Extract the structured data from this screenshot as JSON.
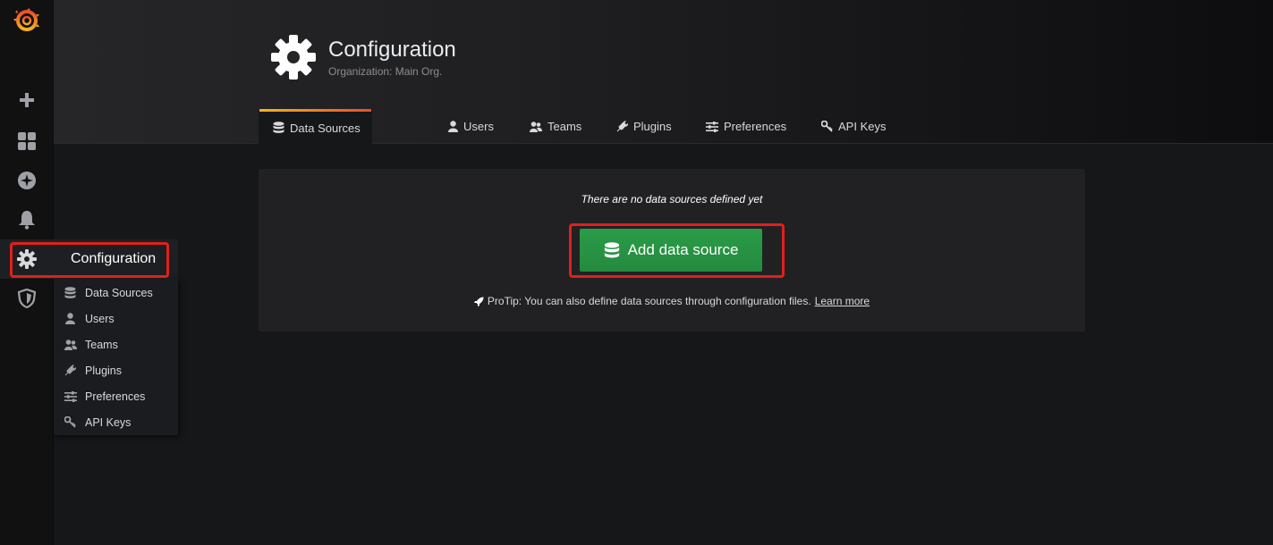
{
  "sidebar": {
    "items": [
      {
        "name": "grafana-logo-icon"
      },
      {
        "name": "plus-icon"
      },
      {
        "name": "dashboards-icon"
      },
      {
        "name": "explore-icon"
      },
      {
        "name": "alerting-bell-icon"
      },
      {
        "name": "gear-icon"
      },
      {
        "name": "shield-icon"
      }
    ]
  },
  "flyout": {
    "header": "Configuration",
    "items": [
      {
        "label": "Data Sources",
        "icon": "database-icon"
      },
      {
        "label": "Users",
        "icon": "user-icon"
      },
      {
        "label": "Teams",
        "icon": "users-icon"
      },
      {
        "label": "Plugins",
        "icon": "plug-icon"
      },
      {
        "label": "Preferences",
        "icon": "sliders-icon"
      },
      {
        "label": "API Keys",
        "icon": "key-icon"
      }
    ]
  },
  "header": {
    "title": "Configuration",
    "subtitle": "Organization: Main Org.",
    "tabs": [
      {
        "label": "Data Sources",
        "icon": "database-icon",
        "active": true
      },
      {
        "label": "Users",
        "icon": "user-icon"
      },
      {
        "label": "Teams",
        "icon": "users-icon"
      },
      {
        "label": "Plugins",
        "icon": "plug-icon"
      },
      {
        "label": "Preferences",
        "icon": "sliders-icon"
      },
      {
        "label": "API Keys",
        "icon": "key-icon"
      }
    ]
  },
  "empty_state": {
    "title": "There are no data sources defined yet",
    "button_label": "Add data source",
    "protip_text": "ProTip: You can also define data sources through configuration files.",
    "protip_link": "Learn more"
  },
  "colors": {
    "accent_gradient_start": "#f4b31b",
    "accent_gradient_end": "#ea4d2c",
    "primary_button": "#299c46",
    "highlight_box": "#e0201b"
  }
}
